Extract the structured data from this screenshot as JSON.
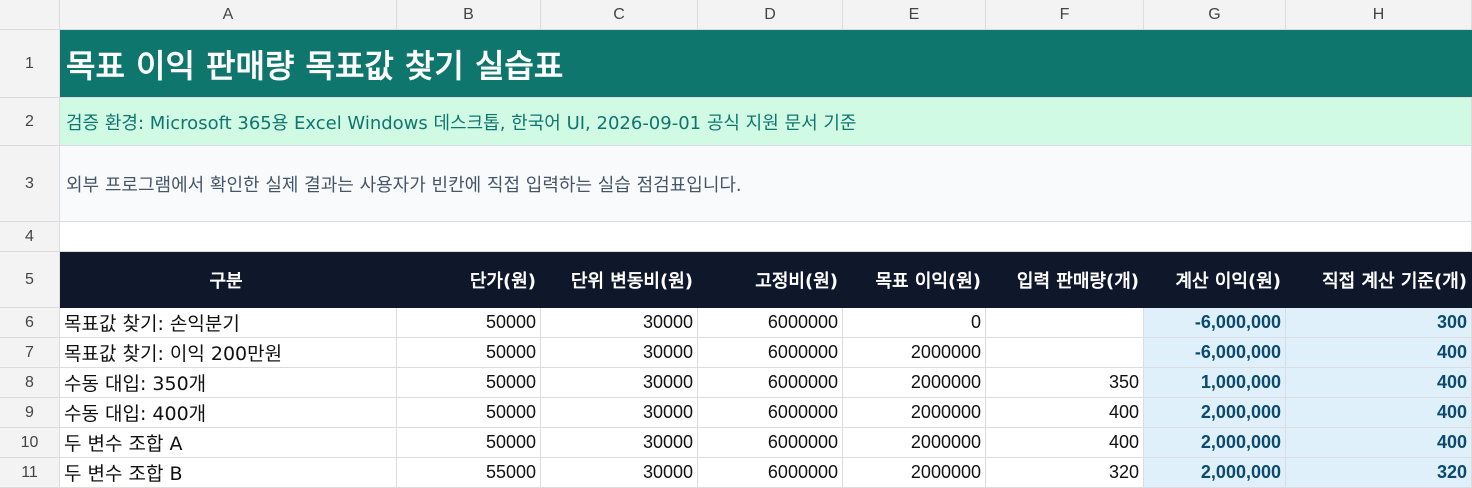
{
  "columns": [
    "A",
    "B",
    "C",
    "D",
    "E",
    "F",
    "G",
    "H"
  ],
  "rows": [
    "1",
    "2",
    "3",
    "4",
    "5",
    "6",
    "7",
    "8",
    "9",
    "10",
    "11"
  ],
  "title": "목표 이익 판매량 목표값 찾기 실습표",
  "environment": "검증 환경: Microsoft 365용 Excel Windows 데스크톱, 한국어 UI, 2026-09-01 공식 지원 문서 기준",
  "note": "외부 프로그램에서 확인한 실제 결과는 사용자가 빈칸에 직접 입력하는 실습 점검표입니다.",
  "headers": [
    "구분",
    "단가(원)",
    "단위 변동비(원)",
    "고정비(원)",
    "목표 이익(원)",
    "입력 판매량(개)",
    "계산 이익(원)",
    "직접 계산 기준(개)"
  ],
  "table": [
    [
      "목표값 찾기: 손익분기",
      "50000",
      "30000",
      "6000000",
      "0",
      "",
      "-6,000,000",
      "300"
    ],
    [
      "목표값 찾기: 이익 200만원",
      "50000",
      "30000",
      "6000000",
      "2000000",
      "",
      "-6,000,000",
      "400"
    ],
    [
      "수동 대입: 350개",
      "50000",
      "30000",
      "6000000",
      "2000000",
      "350",
      "1,000,000",
      "400"
    ],
    [
      "수동 대입: 400개",
      "50000",
      "30000",
      "6000000",
      "2000000",
      "400",
      "2,000,000",
      "400"
    ],
    [
      "두 변수 조합 A",
      "50000",
      "30000",
      "6000000",
      "2000000",
      "400",
      "2,000,000",
      "400"
    ],
    [
      "두 변수 조합 B",
      "55000",
      "30000",
      "6000000",
      "2000000",
      "320",
      "2,000,000",
      "320"
    ]
  ],
  "colors": {
    "title_bg": "#0f766e",
    "env_bg": "#d1fae5",
    "header_bg": "#0f172a",
    "calc_bg": "#e0f0fb",
    "calc_text": "#0b4a6f"
  }
}
